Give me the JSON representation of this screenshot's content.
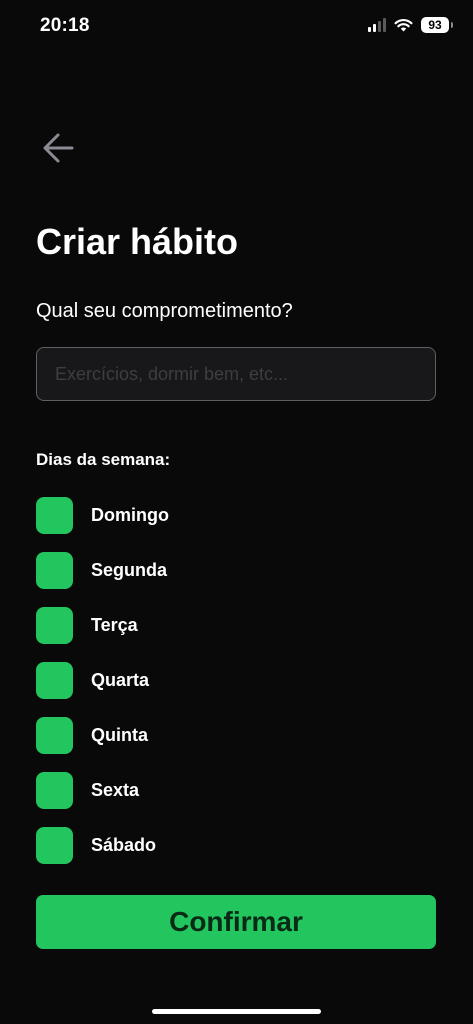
{
  "status_bar": {
    "time": "20:18",
    "battery": "93",
    "icons": [
      "signal-icon",
      "wifi-icon",
      "battery-icon"
    ]
  },
  "header": {
    "back_icon": "arrow-left-icon",
    "title": "Criar hábito"
  },
  "form": {
    "commitment_label": "Qual seu comprometimento?",
    "commitment_value": "",
    "commitment_placeholder": "Exercícios, dormir bem, etc...",
    "days_label": "Dias da semana:",
    "days": [
      {
        "label": "Domingo",
        "checked": false
      },
      {
        "label": "Segunda",
        "checked": false
      },
      {
        "label": "Terça",
        "checked": false
      },
      {
        "label": "Quarta",
        "checked": false
      },
      {
        "label": "Quinta",
        "checked": false
      },
      {
        "label": "Sexta",
        "checked": false
      },
      {
        "label": "Sábado",
        "checked": false
      }
    ],
    "confirm_label": "Confirmar"
  },
  "colors": {
    "background": "#09090a",
    "accent": "#22c55e",
    "input_background": "#18181b",
    "input_border": "#5f5f63",
    "back_icon": "#8b8b93"
  }
}
